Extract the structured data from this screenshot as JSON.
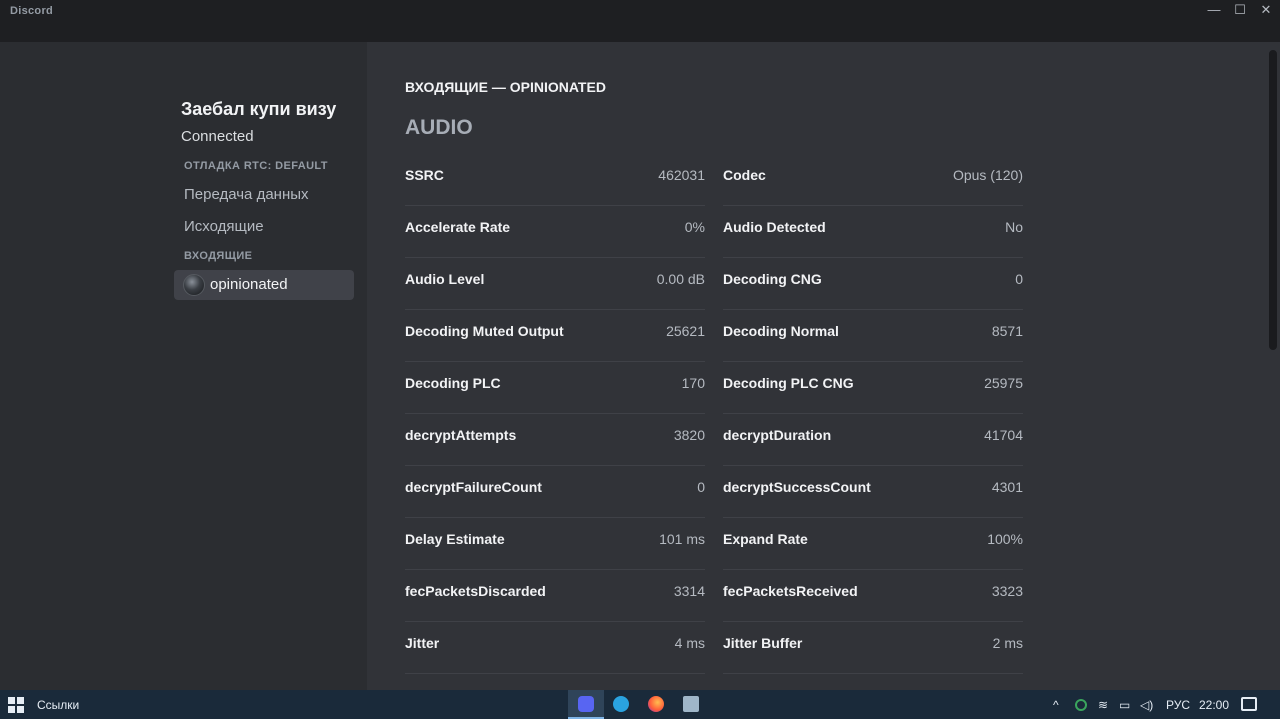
{
  "window": {
    "app_title": "Discord",
    "controls": {
      "minimize": "—",
      "maximize": "☐",
      "close": "✕"
    }
  },
  "sidebar": {
    "channel_title": "Заебал купи визу",
    "connection_status": "Connected",
    "debug_header": "ОТЛАДКА RTC: DEFAULT",
    "items": [
      {
        "label": "Передача данных"
      },
      {
        "label": "Исходящие"
      }
    ],
    "incoming_header": "ВХОДЯЩИЕ",
    "incoming_user": "opinionated"
  },
  "main": {
    "heading": "ВХОДЯЩИЕ — OPINIONATED",
    "section": "AUDIO",
    "stats": [
      {
        "label": "SSRC",
        "value": "462031"
      },
      {
        "label": "Codec",
        "value": "Opus (120)"
      },
      {
        "label": "Accelerate Rate",
        "value": "0%"
      },
      {
        "label": "Audio Detected",
        "value": "No"
      },
      {
        "label": "Audio Level",
        "value": "0.00 dB"
      },
      {
        "label": "Decoding CNG",
        "value": "0"
      },
      {
        "label": "Decoding Muted Output",
        "value": "25621"
      },
      {
        "label": "Decoding Normal",
        "value": "8571"
      },
      {
        "label": "Decoding PLC",
        "value": "170"
      },
      {
        "label": "Decoding PLC CNG",
        "value": "25975"
      },
      {
        "label": "decryptAttempts",
        "value": "3820"
      },
      {
        "label": "decryptDuration",
        "value": "41704"
      },
      {
        "label": "decryptFailureCount",
        "value": "0"
      },
      {
        "label": "decryptSuccessCount",
        "value": "4301"
      },
      {
        "label": "Delay Estimate",
        "value": "101 ms"
      },
      {
        "label": "Expand Rate",
        "value": "100%"
      },
      {
        "label": "fecPacketsDiscarded",
        "value": "3314"
      },
      {
        "label": "fecPacketsReceived",
        "value": "3323"
      },
      {
        "label": "Jitter",
        "value": "4 ms"
      },
      {
        "label": "Jitter Buffer",
        "value": "2 ms"
      }
    ]
  },
  "taskbar": {
    "links_label": "Ссылки",
    "apps": [
      "discord-icon",
      "telegram-icon",
      "firefox-icon",
      "desktop-app-icon"
    ],
    "tray": {
      "language": "РУС",
      "time": "22:00"
    }
  },
  "colors": {
    "sidebar_bg": "#2b2d31",
    "main_bg": "#313338",
    "titlebar_bg": "#1e1f22",
    "taskbar_bg": "#1a2a3a",
    "selected_item_bg": "#404249"
  }
}
